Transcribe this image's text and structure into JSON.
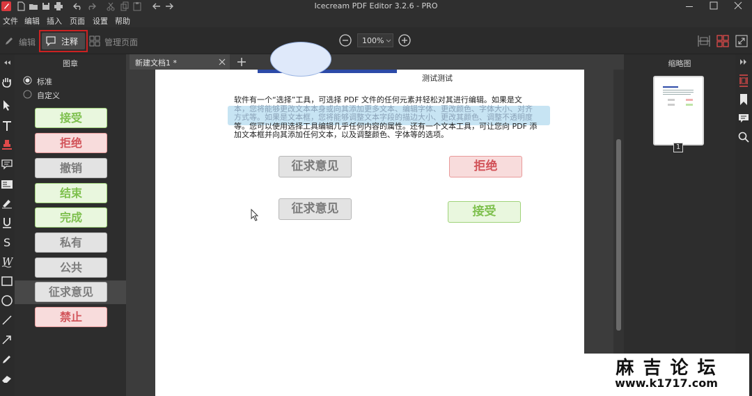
{
  "window": {
    "title": "Icecream PDF Editor 3.2.6 - PRO"
  },
  "menu": [
    "文件",
    "编辑",
    "插入",
    "页面",
    "设置",
    "帮助"
  ],
  "modes": {
    "edit": "编辑",
    "annotate": "注释",
    "manage_pages": "管理页面"
  },
  "zoom": {
    "value": "100%"
  },
  "stamp_panel": {
    "title": "图章",
    "radio_standard": "标准",
    "radio_custom": "自定义",
    "selected_radio": "标准",
    "stamps": [
      {
        "label": "接受",
        "style": "green"
      },
      {
        "label": "拒绝",
        "style": "red"
      },
      {
        "label": "撤销",
        "style": "gray"
      },
      {
        "label": "结束",
        "style": "green"
      },
      {
        "label": "完成",
        "style": "green"
      },
      {
        "label": "私有",
        "style": "gray"
      },
      {
        "label": "公共",
        "style": "gray"
      },
      {
        "label": "征求意见",
        "style": "gray",
        "selected": true
      },
      {
        "label": "禁止",
        "style": "red"
      }
    ]
  },
  "document": {
    "tab_title": "新建文档1 *",
    "page_heading": "测试测试",
    "paragraph_lines": [
      "软件有一个“选择”工具，可选择 PDF 文件的任何元素并轻松对其进行编辑。如果是文",
      "本，您将能够更改文本本身或向其添加更多文本、编辑字体、更改颜色、字体大小、对齐",
      "方式等。如果是文本框，您将能够调整文本字段的描边大小、更改其颜色、调整不透明度",
      "等。您可以使用选择工具编辑几乎任何内容的属性。还有一个文本工具，可让您向 PDF 添",
      "加文本框并向其添加任何文本，以及调整颜色、字体等的选项。"
    ],
    "placed_stamps": [
      {
        "label": "征求意见",
        "style": "gray"
      },
      {
        "label": "拒绝",
        "style": "red"
      },
      {
        "label": "征求意见",
        "style": "gray"
      },
      {
        "label": "接受",
        "style": "green"
      }
    ]
  },
  "thumbnail_panel": {
    "title": "缩略图",
    "page_number": "1"
  },
  "watermark": {
    "title": "麻 吉 论 坛",
    "url": "www.k1717.com"
  },
  "colors": {
    "highlight_box": "#cc2222",
    "accent_red": "#e04a4a",
    "selection_blue": "#c7e4f3"
  }
}
